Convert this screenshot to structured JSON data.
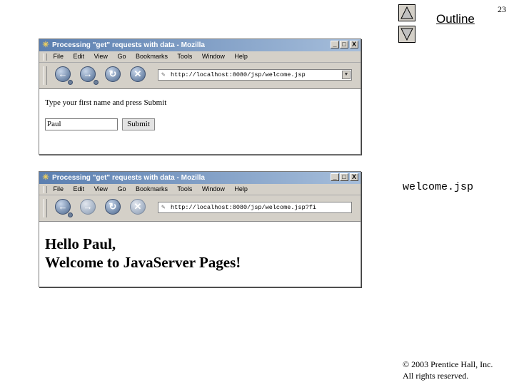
{
  "slide": {
    "outline_label": "Outline",
    "slide_number": "23",
    "file_label": "welcome.jsp",
    "copyright_line1": "© 2003 Prentice Hall, Inc.",
    "copyright_line2": "All rights reserved.",
    "nav_icons": [
      "triangle-up-icon",
      "triangle-down-icon"
    ]
  },
  "browser1": {
    "title": "Processing \"get\" requests with data - Mozilla",
    "window_controls": [
      "_",
      "□",
      "X"
    ],
    "menu": [
      "File",
      "Edit",
      "View",
      "Go",
      "Bookmarks",
      "Tools",
      "Window",
      "Help"
    ],
    "nav_icons": [
      "back-icon",
      "forward-icon",
      "reload-icon",
      "stop-icon"
    ],
    "url": "http://localhost:8080/jsp/welcome.jsp",
    "prompt": "Type your first name and press Submit",
    "name_value": "Paul",
    "submit_label": "Submit"
  },
  "browser2": {
    "title": "Processing \"get\" requests with data - Mozilla",
    "window_controls": [
      "_",
      "□",
      "X"
    ],
    "menu": [
      "File",
      "Edit",
      "View",
      "Go",
      "Bookmarks",
      "Tools",
      "Window",
      "Help"
    ],
    "nav_icons": [
      "back-icon",
      "forward-icon",
      "reload-icon",
      "stop-icon"
    ],
    "url": "http://localhost:8080/jsp/welcome.jsp?fi",
    "greeting_line1": "Hello Paul,",
    "greeting_line2": "Welcome to JavaServer Pages!"
  },
  "colors": {
    "titlebar_start": "#5b7fb0",
    "titlebar_end": "#a6bedb",
    "chrome_gray": "#d4d0c8"
  }
}
